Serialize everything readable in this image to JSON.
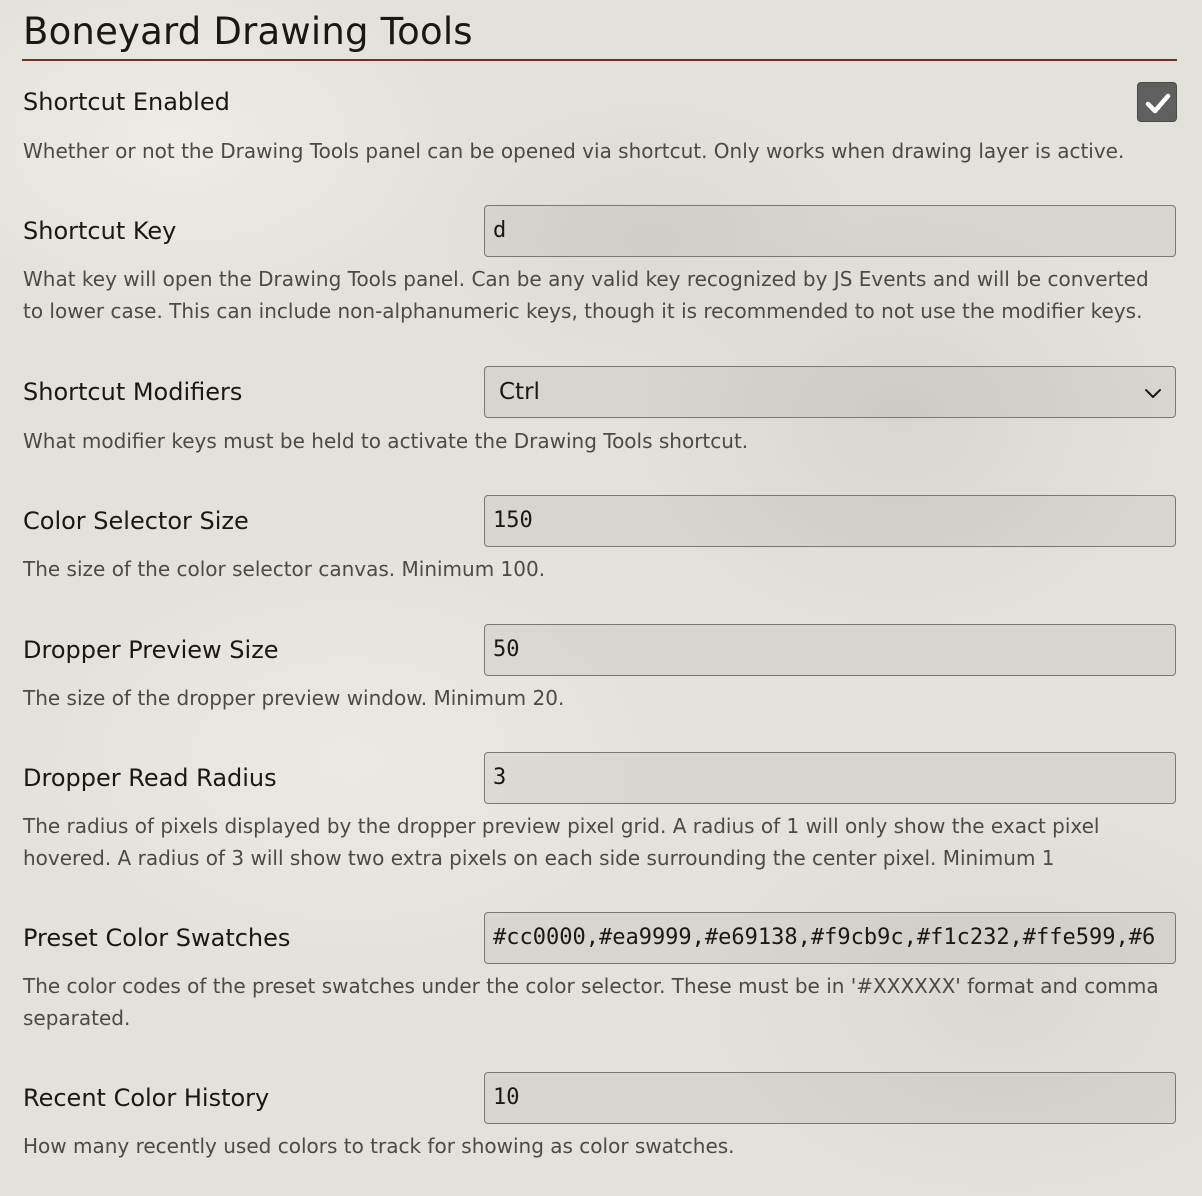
{
  "section": {
    "title": "Boneyard Drawing Tools"
  },
  "settings": {
    "shortcut_enabled": {
      "label": "Shortcut Enabled",
      "checked": true,
      "hint": "Whether or not the Drawing Tools panel can be opened via shortcut. Only works when drawing layer is active."
    },
    "shortcut_key": {
      "label": "Shortcut Key",
      "value": "d",
      "hint": "What key will open the Drawing Tools panel. Can be any valid key recognized by JS Events and will be converted to lower case. This can include non-alphanumeric keys, though it is recommended to not use the modifier keys."
    },
    "shortcut_modifiers": {
      "label": "Shortcut Modifiers",
      "value": "Ctrl",
      "hint": "What modifier keys must be held to activate the Drawing Tools shortcut."
    },
    "color_selector_size": {
      "label": "Color Selector Size",
      "value": "150",
      "hint": "The size of the color selector canvas. Minimum 100."
    },
    "dropper_preview_size": {
      "label": "Dropper Preview Size",
      "value": "50",
      "hint": "The size of the dropper preview window. Minimum 20."
    },
    "dropper_read_radius": {
      "label": "Dropper Read Radius",
      "value": "3",
      "hint": "The radius of pixels displayed by the dropper preview pixel grid. A radius of 1 will only show the exact pixel hovered. A radius of 3 will show two extra pixels on each side surrounding the center pixel. Minimum 1"
    },
    "preset_color_swatches": {
      "label": "Preset Color Swatches",
      "value": "#cc0000,#ea9999,#e69138,#f9cb9c,#f1c232,#ffe599,#6",
      "hint": "The color codes of the preset swatches under the color selector. These must be in '#XXXXXX' format and comma separated."
    },
    "recent_color_history": {
      "label": "Recent Color History",
      "value": "10",
      "hint": "How many recently used colors to track for showing as color swatches."
    }
  },
  "colors": {
    "accent_rule": "#782e22",
    "checkbox_bg": "#5f5f5f"
  },
  "icons": {
    "checkbox": "checkmark-icon",
    "select": "chevron-down-icon"
  }
}
